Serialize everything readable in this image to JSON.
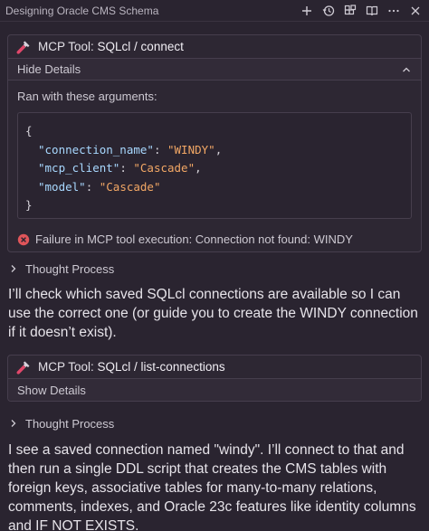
{
  "window": {
    "title": "Designing Oracle CMS Schema"
  },
  "tool1": {
    "prefix": "MCP Tool:",
    "name": "SQLcl / connect",
    "toggle_label": "Hide Details",
    "ran_label": "Ran with these arguments:",
    "code": {
      "open": "{",
      "close": "}",
      "lines": [
        {
          "key": "\"connection_name\"",
          "value": "\"WINDY\"",
          "trail": ","
        },
        {
          "key": "\"mcp_client\"",
          "value": "\"Cascade\"",
          "trail": ","
        },
        {
          "key": "\"model\"",
          "value": "\"Cascade\"",
          "trail": ""
        }
      ]
    },
    "error": "Failure in MCP tool execution: Connection not found: WINDY"
  },
  "thought1": {
    "label": "Thought Process"
  },
  "message1": "I’ll check which saved SQLcl connections are available so I can use the correct one (or guide you to create the WINDY connection if it doesn’t exist).",
  "tool2": {
    "prefix": "MCP Tool:",
    "name": "SQLcl / list-connections",
    "toggle_label": "Show Details"
  },
  "thought2": {
    "label": "Thought Process"
  },
  "message2": "I see a saved connection named \"windy\". I’ll connect to that and then run a single DDL script that creates the CMS tables with foreign keys, associative tables for many-to-many relations, comments, indexes, and Oracle 23c features like identity columns and IF NOT EXISTS.",
  "colors": {
    "background": "#2a2430",
    "json_key": "#a8d8ff",
    "json_string": "#f2a765",
    "error": "#e0555a"
  }
}
